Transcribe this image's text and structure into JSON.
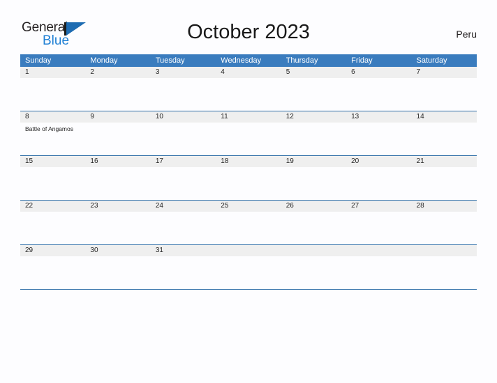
{
  "brand": {
    "name_part1": "General",
    "name_part2": "Blue",
    "flag_icon": "flag-triangle-icon"
  },
  "header": {
    "title": "October 2023",
    "country": "Peru"
  },
  "colors": {
    "header_blue": "#3a7cbe",
    "row_border_blue": "#2f6fa8",
    "date_band_gray": "#efefef",
    "page_background": "#fdfdff",
    "brand_blue": "#1e7fd4",
    "flag_blue": "#1e6cb2"
  },
  "calendar": {
    "weekdays": [
      "Sunday",
      "Monday",
      "Tuesday",
      "Wednesday",
      "Thursday",
      "Friday",
      "Saturday"
    ],
    "weeks": [
      {
        "days": [
          {
            "number": "1",
            "events": []
          },
          {
            "number": "2",
            "events": []
          },
          {
            "number": "3",
            "events": []
          },
          {
            "number": "4",
            "events": []
          },
          {
            "number": "5",
            "events": []
          },
          {
            "number": "6",
            "events": []
          },
          {
            "number": "7",
            "events": []
          }
        ]
      },
      {
        "days": [
          {
            "number": "8",
            "events": [
              "Battle of Angamos"
            ]
          },
          {
            "number": "9",
            "events": []
          },
          {
            "number": "10",
            "events": []
          },
          {
            "number": "11",
            "events": []
          },
          {
            "number": "12",
            "events": []
          },
          {
            "number": "13",
            "events": []
          },
          {
            "number": "14",
            "events": []
          }
        ]
      },
      {
        "days": [
          {
            "number": "15",
            "events": []
          },
          {
            "number": "16",
            "events": []
          },
          {
            "number": "17",
            "events": []
          },
          {
            "number": "18",
            "events": []
          },
          {
            "number": "19",
            "events": []
          },
          {
            "number": "20",
            "events": []
          },
          {
            "number": "21",
            "events": []
          }
        ]
      },
      {
        "days": [
          {
            "number": "22",
            "events": []
          },
          {
            "number": "23",
            "events": []
          },
          {
            "number": "24",
            "events": []
          },
          {
            "number": "25",
            "events": []
          },
          {
            "number": "26",
            "events": []
          },
          {
            "number": "27",
            "events": []
          },
          {
            "number": "28",
            "events": []
          }
        ]
      },
      {
        "days": [
          {
            "number": "29",
            "events": []
          },
          {
            "number": "30",
            "events": []
          },
          {
            "number": "31",
            "events": []
          },
          {
            "number": "",
            "events": []
          },
          {
            "number": "",
            "events": []
          },
          {
            "number": "",
            "events": []
          },
          {
            "number": "",
            "events": []
          }
        ]
      }
    ]
  }
}
